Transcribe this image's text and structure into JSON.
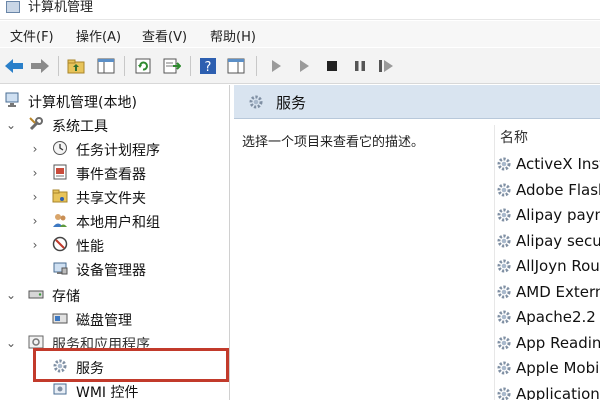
{
  "window": {
    "title": "计算机管理"
  },
  "menu": {
    "file": "文件(F)",
    "action": "操作(A)",
    "view": "查看(V)",
    "help": "帮助(H)"
  },
  "tree": {
    "root": "计算机管理(本地)",
    "system_tools": "系统工具",
    "task_scheduler": "任务计划程序",
    "event_viewer": "事件查看器",
    "shared_folders": "共享文件夹",
    "local_users": "本地用户和组",
    "performance": "性能",
    "device_manager": "设备管理器",
    "storage": "存储",
    "disk_management": "磁盘管理",
    "services_apps": "服务和应用程序",
    "services": "服务",
    "wmi": "WMI 控件"
  },
  "panel": {
    "title": "服务",
    "description": "选择一个项目来查看它的描述。",
    "column_name": "名称",
    "services": [
      "ActiveX Inst",
      "Adobe Flash",
      "Alipay paym",
      "Alipay secur",
      "AllJoyn Rou",
      "AMD Extern",
      "Apache2.2",
      "App Reading",
      "Apple Mobi",
      "Application"
    ]
  },
  "colors": {
    "highlight_border": "#c23a2b",
    "panel_header": "#d9e4f0"
  }
}
